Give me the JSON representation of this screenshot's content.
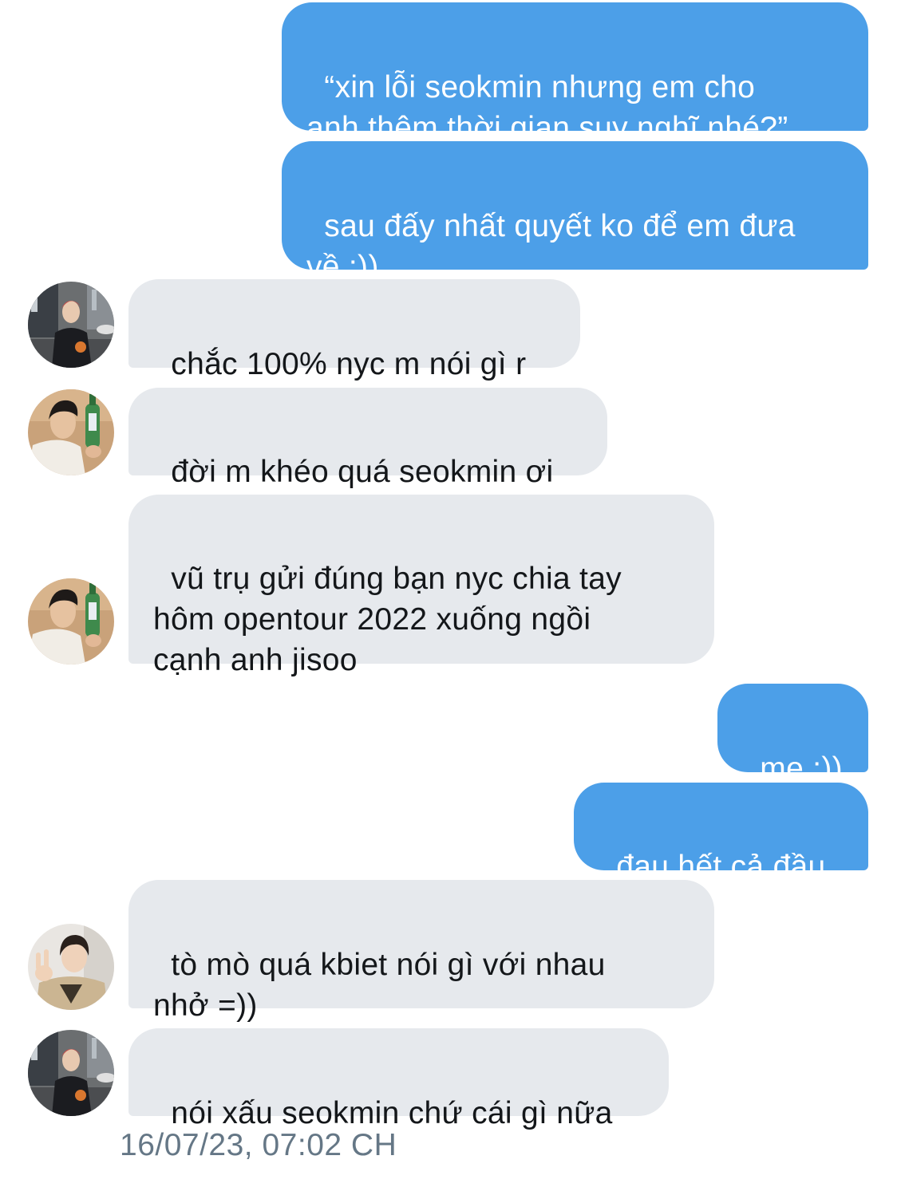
{
  "colors": {
    "outgoing_bubble": "#4c9fe8",
    "incoming_bubble": "#e6e9ed",
    "timestamp_text": "#657786"
  },
  "conversation": {
    "messages": [
      {
        "direction": "outgoing",
        "text": "“xin lỗi seokmin nhưng em cho\nanh thêm thời gian suy nghĩ nhé?”"
      },
      {
        "direction": "outgoing",
        "text": "sau đấy nhất quyết ko để em đưa\nvề :))"
      },
      {
        "direction": "incoming",
        "sender_avatar": "street-portrait-avatar",
        "text": "chắc 100% nyc m nói gì r"
      },
      {
        "direction": "incoming",
        "sender_avatar": "bottle-portrait-avatar",
        "text": "đời m khéo quá seokmin ơi"
      },
      {
        "direction": "incoming",
        "sender_avatar": "bottle-portrait-avatar",
        "text": "vũ trụ gửi đúng bạn nyc chia tay\nhôm opentour 2022 xuống ngồi\ncạnh anh jisoo"
      },
      {
        "direction": "outgoing",
        "text": "mẹ :))"
      },
      {
        "direction": "outgoing",
        "text": "đau hết cả đầu"
      },
      {
        "direction": "incoming",
        "sender_avatar": "peace-sign-portrait-avatar",
        "text": "tò mò quá kbiet nói gì với nhau\nnhở =))"
      },
      {
        "direction": "incoming",
        "sender_avatar": "street-portrait-avatar",
        "text": "nói xấu seokmin chứ cái gì nữa"
      }
    ],
    "timestamp": "16/07/23, 07:02 CH"
  }
}
